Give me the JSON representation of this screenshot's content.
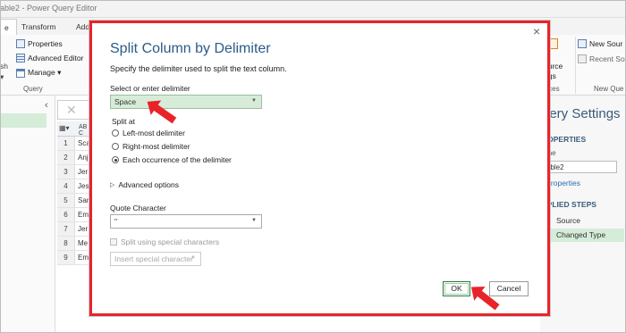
{
  "window": {
    "title": "able2 - Power Query Editor"
  },
  "ribbon_tabs": [
    {
      "label": "e"
    },
    {
      "label": "Transform"
    },
    {
      "label": "Add"
    }
  ],
  "ribbon": {
    "properties": "Properties",
    "advanced_editor": "Advanced Editor",
    "manage": "Manage ▾",
    "query_group": "Query",
    "left_fragment": "sh",
    "left_fragment2": "▾",
    "source_fragment1": "ource",
    "source_fragment2": "ngs",
    "sources_fragment": "urces",
    "new_source": "New Sour",
    "recent_sources": "Recent So",
    "new_query_group": "New Que"
  },
  "table": {
    "header_fragment": "AB C",
    "rows": [
      {
        "num": "1",
        "cell": "Sca"
      },
      {
        "num": "2",
        "cell": "Anj"
      },
      {
        "num": "3",
        "cell": "Jer"
      },
      {
        "num": "4",
        "cell": "Jes"
      },
      {
        "num": "5",
        "cell": "Sar"
      },
      {
        "num": "6",
        "cell": "Em"
      },
      {
        "num": "7",
        "cell": "Jer"
      },
      {
        "num": "8",
        "cell": "Me"
      },
      {
        "num": "9",
        "cell": "Em"
      }
    ]
  },
  "query_settings": {
    "title": "uery Settings",
    "properties_header": "ROPERTIES",
    "name_label": "ame",
    "name_value": "able2",
    "all_properties": "l Properties",
    "applied_steps_header": "PPLIED STEPS",
    "steps": [
      {
        "label": "Source",
        "selected": false
      },
      {
        "label": "Changed Type",
        "selected": true
      }
    ]
  },
  "dialog": {
    "title": "Split Column by Delimiter",
    "subtitle": "Specify the delimiter used to split the text column.",
    "delimiter_label": "Select or enter delimiter",
    "delimiter_value": "Space",
    "split_at_label": "Split at",
    "split_options": [
      {
        "label": "Left-most delimiter",
        "selected": false
      },
      {
        "label": "Right-most delimiter",
        "selected": false
      },
      {
        "label": "Each occurrence of the delimiter",
        "selected": true
      }
    ],
    "advanced_options": "Advanced options",
    "quote_label": "Quote Character",
    "quote_value": "\"",
    "special_chars_label": "Split using special characters",
    "insert_special": "Insert special character",
    "ok": "OK",
    "cancel": "Cancel",
    "close_glyph": "×"
  },
  "colors": {
    "annotation_red": "#e8242a",
    "selected_green": "#d6ecd8",
    "title_blue": "#2a5b88"
  }
}
